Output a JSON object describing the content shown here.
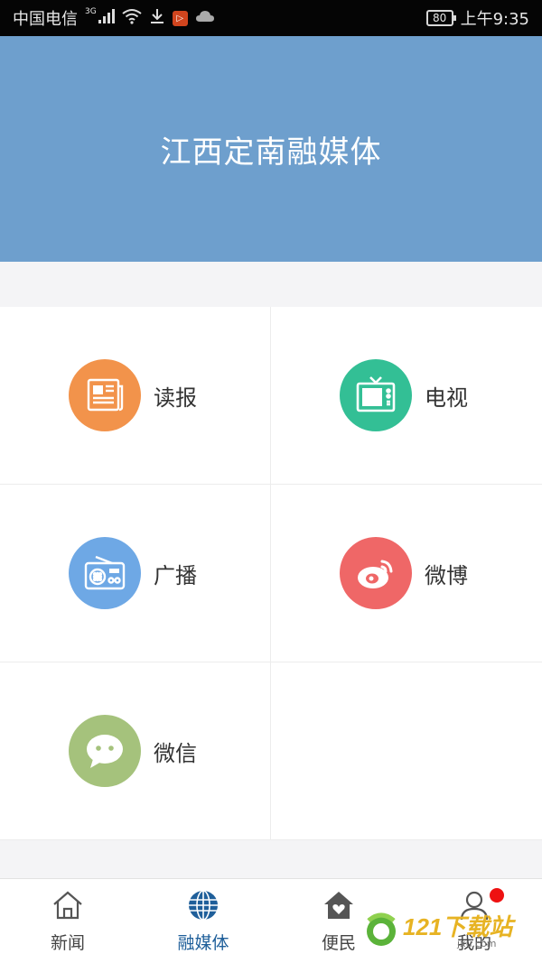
{
  "status_bar": {
    "carrier": "中国电信",
    "network": "3G",
    "battery": "80",
    "time": "上午9:35",
    "app_badge_glyph": "▷"
  },
  "header": {
    "title": "江西定南融媒体"
  },
  "grid": {
    "items": [
      {
        "label": "读报",
        "icon": "newspaper-icon",
        "color": "#f2934b"
      },
      {
        "label": "电视",
        "icon": "tv-icon",
        "color": "#33bf95"
      },
      {
        "label": "广播",
        "icon": "radio-icon",
        "color": "#6ea8e5"
      },
      {
        "label": "微博",
        "icon": "weibo-icon",
        "color": "#ef6767"
      },
      {
        "label": "微信",
        "icon": "wechat-icon",
        "color": "#a5c27c"
      }
    ]
  },
  "tabbar": {
    "tabs": [
      {
        "label": "新闻",
        "icon": "home-icon",
        "active": false
      },
      {
        "label": "融媒体",
        "icon": "globe-icon",
        "active": true
      },
      {
        "label": "便民",
        "icon": "house-heart-icon",
        "active": false
      },
      {
        "label": "我的",
        "icon": "user-icon",
        "active": false,
        "has_badge": true
      }
    ],
    "active_color": "#1f5f9a"
  },
  "watermark": {
    "brand": "121下载站",
    "domain": "jxu.com"
  }
}
